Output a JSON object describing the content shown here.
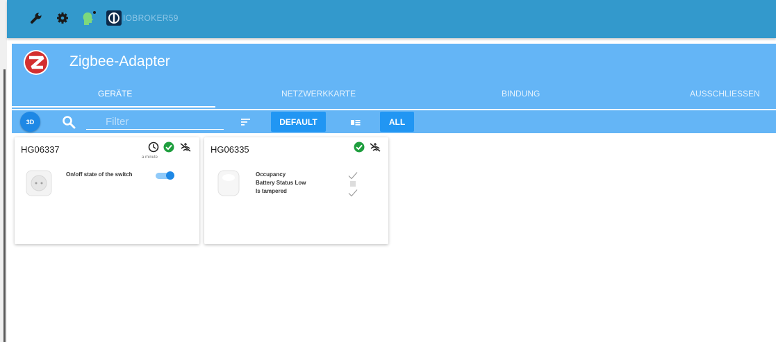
{
  "topbar": {
    "host": "IOBROKER59",
    "icons": [
      "wrench-icon",
      "gear-icon",
      "head-icon",
      "power-logo-icon"
    ]
  },
  "adapter": {
    "title": "Zigbee-Adapter",
    "tabs": [
      {
        "label": "GERÄTE",
        "active": true
      },
      {
        "label": "NETZWERKKARTE",
        "active": false
      },
      {
        "label": "BINDUNG",
        "active": false
      },
      {
        "label": "AUSSCHLIESSEN",
        "active": false
      }
    ]
  },
  "toolbar": {
    "three_d": "3D",
    "filter_placeholder": "Filter",
    "default_label": "DEFAULT",
    "all_label": "ALL"
  },
  "devices": [
    {
      "name": "HG06337",
      "last_seen": "a minute",
      "states": [
        {
          "label": "On/off state of the switch",
          "value": "on"
        }
      ]
    },
    {
      "name": "HG06335",
      "states": [
        {
          "label": "Occupancy",
          "value": "checked"
        },
        {
          "label": "Battery Status Low",
          "value": "indeterminate"
        },
        {
          "label": "Is tampered",
          "value": "checked"
        }
      ]
    }
  ],
  "colors": {
    "topbar": "#3399cc",
    "panel": "#64b5f6",
    "button": "#2196f3",
    "ok": "#1e9e3e"
  }
}
